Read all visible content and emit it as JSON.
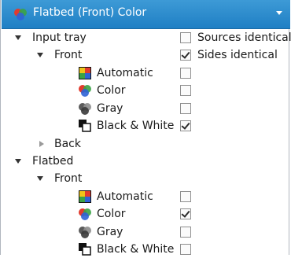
{
  "header": {
    "title": "Flatbed (Front) Color",
    "icon": "color-mode-icon"
  },
  "tree": {
    "input_tray": {
      "label": "Input tray",
      "expanded": true,
      "front": {
        "label": "Front",
        "expanded": true,
        "items": [
          {
            "label": "Automatic",
            "icon": "automatic-mode-icon",
            "checked": false
          },
          {
            "label": "Color",
            "icon": "color-mode-icon",
            "checked": false
          },
          {
            "label": "Gray",
            "icon": "gray-mode-icon",
            "checked": false
          },
          {
            "label": "Black & White",
            "icon": "black-white-mode-icon",
            "checked": true
          }
        ]
      },
      "back": {
        "label": "Back",
        "expanded": false
      }
    },
    "flatbed": {
      "label": "Flatbed",
      "expanded": true,
      "front": {
        "label": "Front",
        "expanded": true,
        "items": [
          {
            "label": "Automatic",
            "icon": "automatic-mode-icon",
            "checked": false
          },
          {
            "label": "Color",
            "icon": "color-mode-icon",
            "checked": true
          },
          {
            "label": "Gray",
            "icon": "gray-mode-icon",
            "checked": false
          },
          {
            "label": "Black & White",
            "icon": "black-white-mode-icon",
            "checked": false
          }
        ]
      }
    }
  },
  "options": {
    "sources_identical": {
      "label": "Sources identical",
      "checked": false
    },
    "sides_identical": {
      "label": "Sides identical",
      "checked": true
    }
  }
}
